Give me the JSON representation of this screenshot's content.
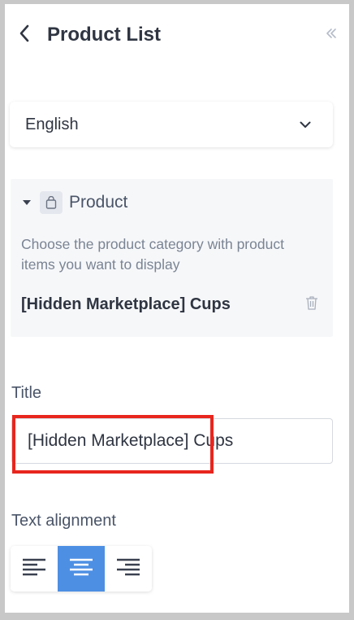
{
  "header": {
    "title": "Product List",
    "back_icon": "chevron-left-icon",
    "collapse_icon": "double-chevron-left-icon"
  },
  "language": {
    "selected": "English",
    "icon": "chevron-down-icon"
  },
  "product": {
    "label": "Product",
    "description": "Choose the product category with product items you want to display",
    "selected_item": "[Hidden Marketplace] Cups",
    "icons": [
      "caret-down-icon",
      "shopping-bag-icon",
      "trash-icon"
    ]
  },
  "title_field": {
    "label": "Title",
    "value": "[Hidden Marketplace] Cups"
  },
  "alignment": {
    "label": "Text alignment",
    "options": [
      "align-left-icon",
      "align-center-icon",
      "align-right-icon"
    ],
    "selected": "center"
  },
  "colors": {
    "accent": "#4d8fe3",
    "highlight": "#e8261e",
    "panel_bg": "#f6f7f9"
  }
}
